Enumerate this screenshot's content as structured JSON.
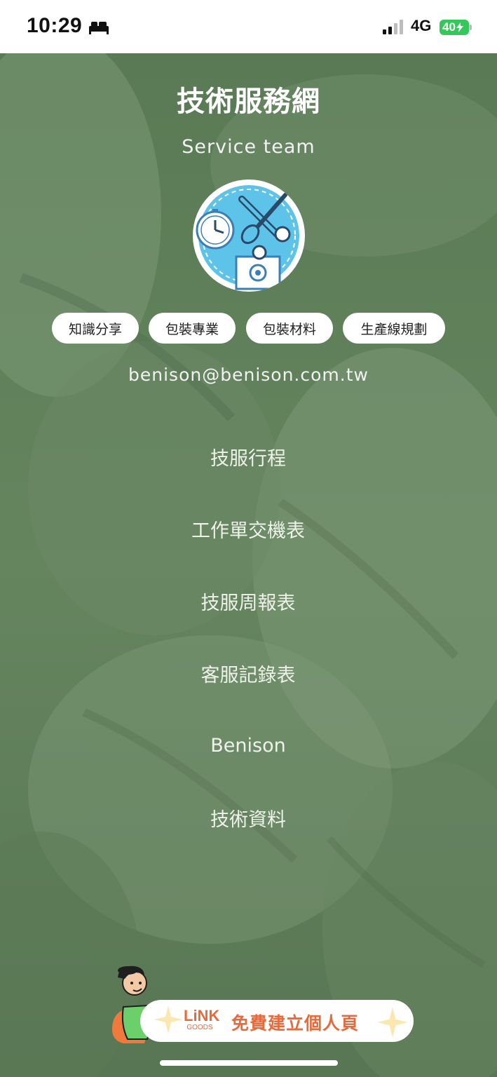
{
  "status_bar": {
    "time": "10:29",
    "network": "4G",
    "battery": "40"
  },
  "profile": {
    "title": "技術服務網",
    "subtitle": "Service team",
    "email": "benison@benison.com.tw",
    "tags": [
      "知識分享",
      "包裝專業",
      "包裝材料",
      "生產線規劃"
    ]
  },
  "links": [
    "技服行程",
    "工作單交機表",
    "技服周報表",
    "客服記錄表",
    "Benison",
    "技術資料"
  ],
  "promo": {
    "logo_main": "LiNK",
    "logo_sub": "GOODS",
    "text": "免費建立個人頁"
  },
  "colors": {
    "background": "#5f7e5a",
    "accent": "#e86a3b",
    "battery": "#34c759"
  }
}
